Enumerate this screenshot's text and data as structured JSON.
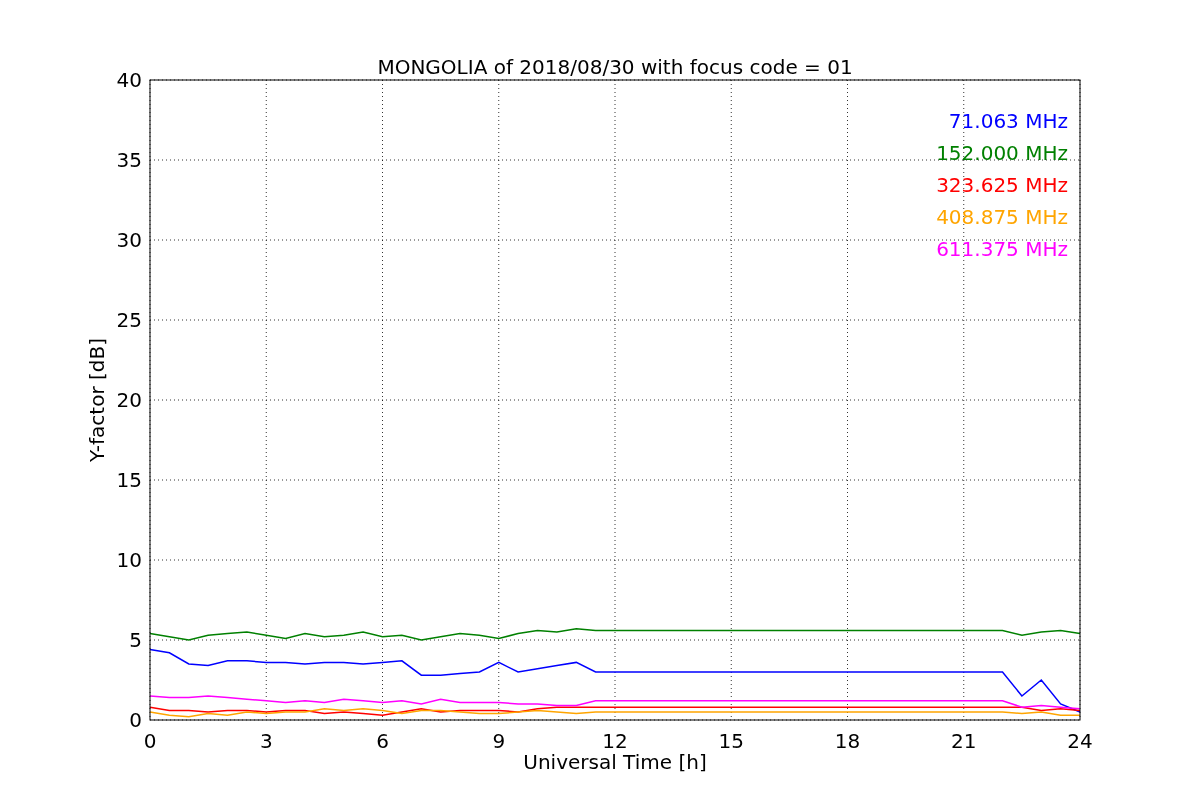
{
  "figure": {
    "chart_data": {
      "type": "line",
      "title": "MONGOLIA of 2018/08/30 with focus code = 01",
      "xlabel": "Universal Time [h]",
      "ylabel": "Y-factor [dB]",
      "x": [
        0,
        0.5,
        1,
        1.5,
        2,
        2.5,
        3,
        3.5,
        4,
        4.5,
        5,
        5.5,
        6,
        6.5,
        7,
        7.5,
        8,
        8.5,
        9,
        9.5,
        10,
        10.5,
        11,
        11.5,
        12,
        12.5,
        13,
        13.5,
        14,
        14.5,
        15,
        15.5,
        16,
        16.5,
        17,
        17.5,
        18,
        18.5,
        19,
        19.5,
        20,
        20.5,
        21,
        21.5,
        22,
        22.5,
        23,
        23.5,
        24
      ],
      "series": [
        {
          "name": "71.063 MHz",
          "color": "#0000ff",
          "values": [
            4.4,
            4.2,
            3.5,
            3.4,
            3.7,
            3.7,
            3.6,
            3.6,
            3.5,
            3.6,
            3.6,
            3.5,
            3.6,
            3.7,
            2.8,
            2.8,
            2.9,
            3.0,
            3.6,
            3.0,
            3.2,
            3.4,
            3.6,
            3.0,
            3.0,
            3.0,
            3.0,
            3.0,
            3.0,
            3.0,
            3.0,
            3.0,
            3.0,
            3.0,
            3.0,
            3.0,
            3.0,
            3.0,
            3.0,
            3.0,
            3.0,
            3.0,
            3.0,
            3.0,
            3.0,
            1.5,
            2.5,
            1.0,
            0.5
          ]
        },
        {
          "name": "152.000 MHz",
          "color": "#008000",
          "values": [
            5.4,
            5.2,
            5.0,
            5.3,
            5.4,
            5.5,
            5.3,
            5.1,
            5.4,
            5.2,
            5.3,
            5.5,
            5.2,
            5.3,
            5.0,
            5.2,
            5.4,
            5.3,
            5.1,
            5.4,
            5.6,
            5.5,
            5.7,
            5.6,
            5.6,
            5.6,
            5.6,
            5.6,
            5.6,
            5.6,
            5.6,
            5.6,
            5.6,
            5.6,
            5.6,
            5.6,
            5.6,
            5.6,
            5.6,
            5.6,
            5.6,
            5.6,
            5.6,
            5.6,
            5.6,
            5.3,
            5.5,
            5.6,
            5.4
          ]
        },
        {
          "name": "323.625 MHz",
          "color": "#ff0000",
          "values": [
            0.8,
            0.6,
            0.6,
            0.5,
            0.6,
            0.6,
            0.5,
            0.6,
            0.6,
            0.4,
            0.5,
            0.4,
            0.3,
            0.5,
            0.7,
            0.5,
            0.6,
            0.6,
            0.6,
            0.5,
            0.7,
            0.8,
            0.8,
            0.8,
            0.8,
            0.8,
            0.8,
            0.8,
            0.8,
            0.8,
            0.8,
            0.8,
            0.8,
            0.8,
            0.8,
            0.8,
            0.8,
            0.8,
            0.8,
            0.8,
            0.8,
            0.8,
            0.8,
            0.8,
            0.8,
            0.8,
            0.6,
            0.7,
            0.6
          ]
        },
        {
          "name": "408.875 MHz",
          "color": "#ffa500",
          "values": [
            0.5,
            0.3,
            0.2,
            0.4,
            0.3,
            0.5,
            0.4,
            0.5,
            0.5,
            0.7,
            0.6,
            0.7,
            0.6,
            0.4,
            0.6,
            0.6,
            0.5,
            0.4,
            0.4,
            0.5,
            0.6,
            0.5,
            0.4,
            0.5,
            0.5,
            0.5,
            0.5,
            0.5,
            0.5,
            0.5,
            0.5,
            0.5,
            0.5,
            0.5,
            0.5,
            0.5,
            0.5,
            0.5,
            0.5,
            0.5,
            0.5,
            0.5,
            0.5,
            0.5,
            0.5,
            0.4,
            0.5,
            0.3,
            0.3
          ]
        },
        {
          "name": "611.375 MHz",
          "color": "#ff00ff",
          "values": [
            1.5,
            1.4,
            1.4,
            1.5,
            1.4,
            1.3,
            1.2,
            1.1,
            1.2,
            1.1,
            1.3,
            1.2,
            1.1,
            1.2,
            1.0,
            1.3,
            1.1,
            1.1,
            1.1,
            1.0,
            1.0,
            0.9,
            0.9,
            1.2,
            1.2,
            1.2,
            1.2,
            1.2,
            1.2,
            1.2,
            1.2,
            1.2,
            1.2,
            1.2,
            1.2,
            1.2,
            1.2,
            1.2,
            1.2,
            1.2,
            1.2,
            1.2,
            1.2,
            1.2,
            1.2,
            0.8,
            0.9,
            0.8,
            0.7
          ]
        }
      ],
      "grid": true,
      "xlim": [
        0,
        24
      ],
      "ylim": [
        0,
        40
      ],
      "xticks": [
        0,
        3,
        6,
        9,
        12,
        15,
        18,
        21,
        24
      ],
      "yticks": [
        0,
        5,
        10,
        15,
        20,
        25,
        30,
        35,
        40
      ]
    }
  }
}
